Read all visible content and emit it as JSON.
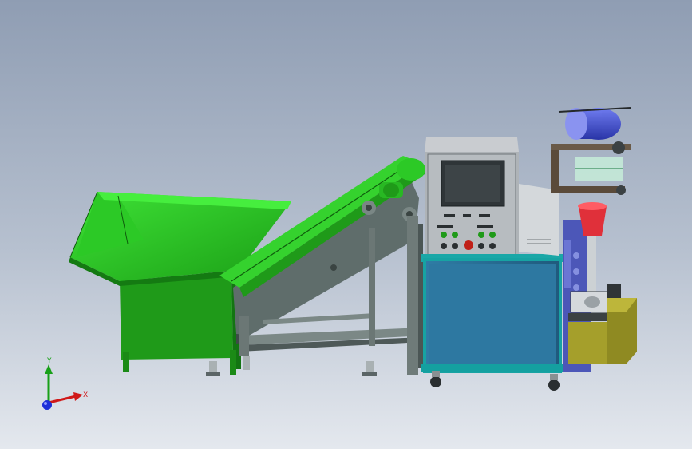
{
  "scene": {
    "background_top": "#8f9db3",
    "background_bottom": "#e4e8ee",
    "colors": {
      "hopper_green": "#2fd62a",
      "hopper_green_dark": "#1c8f17",
      "frame_grey": "#5d6a6a",
      "cabinet_blue": "#2a6f96",
      "cabinet_frame": "#18a6a6",
      "panel_grey": "#b8bcc0",
      "roll_blue": "#3f4fd0",
      "box_olive": "#8f8a22"
    }
  },
  "triad": {
    "x_label": "X",
    "y_label": "Y",
    "icon": "coordinate-axes-icon"
  }
}
